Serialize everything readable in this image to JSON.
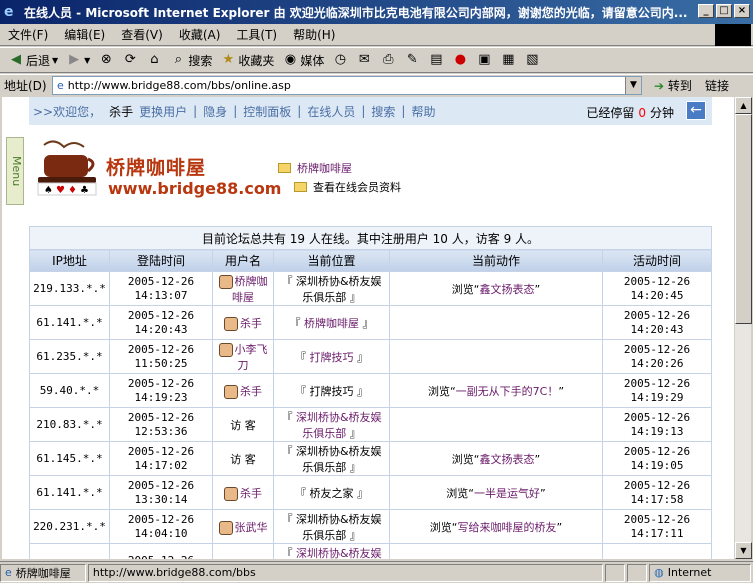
{
  "window": {
    "title": "在线人员 - Microsoft Internet Explorer 由 欢迎光临深圳市比克电池有限公司内部网，谢谢您的光临，请留意公司内...",
    "buttons": [
      "_",
      "□",
      "×"
    ]
  },
  "menubar": [
    "文件(F)",
    "编辑(E)",
    "查看(V)",
    "收藏(A)",
    "工具(T)",
    "帮助(H)"
  ],
  "toolbar": {
    "back": "后退",
    "search": "搜索",
    "favorites": "收藏夹",
    "media": "媒体"
  },
  "address": {
    "label": "地址(D)",
    "url": "http://www.bridge88.com/bbs/online.asp",
    "go": "转到",
    "links": "链接"
  },
  "forum_nav": {
    "welcome": ">>欢迎您，",
    "user": "杀手",
    "items": [
      "更换用户",
      "隐身",
      "控制面板",
      "在线人员",
      "搜索",
      "帮助"
    ],
    "stay_prefix": "已经停留",
    "stay_minutes": "0",
    "stay_suffix": "分钟"
  },
  "menu_tab": "Menu",
  "brand": {
    "cn": "桥牌咖啡屋",
    "en": "www.bridge88.com"
  },
  "breadcrumb": {
    "home": "桥牌咖啡屋",
    "current": "查看在线会员资料"
  },
  "summary": "目前论坛总共有 19 人在线。其中注册用户 10 人，访客 9 人。",
  "columns": [
    "IP地址",
    "登陆时间",
    "用户名",
    "当前位置",
    "当前动作",
    "活动时间"
  ],
  "rows": [
    {
      "ip": "219.133.*.*",
      "login_date": "2005-12-26",
      "login_time": "14:13:07",
      "user": "桥牌咖啡屋",
      "loc": "深圳桥协&桥友娱乐俱乐部",
      "loc_link": false,
      "act_prefix": "浏览",
      "act": "鑫文扬表态",
      "act_date": "2005-12-26",
      "act_time": "14:20:45"
    },
    {
      "ip": "61.141.*.*",
      "login_date": "2005-12-26",
      "login_time": "14:20:43",
      "user": "杀手",
      "loc": "桥牌咖啡屋",
      "loc_link": true,
      "act_prefix": "",
      "act": "",
      "act_date": "2005-12-26",
      "act_time": "14:20:43"
    },
    {
      "ip": "61.235.*.*",
      "login_date": "2005-12-26",
      "login_time": "11:50:25",
      "user": "小李飞刀",
      "loc": "打牌技巧",
      "loc_link": true,
      "act_prefix": "",
      "act": "",
      "act_date": "2005-12-26",
      "act_time": "14:20:26"
    },
    {
      "ip": "59.40.*.*",
      "login_date": "2005-12-26",
      "login_time": "14:19:23",
      "user": "杀手",
      "loc": "打牌技巧",
      "loc_link": false,
      "act_prefix": "浏览",
      "act": "一副无从下手的7C！",
      "act_date": "2005-12-26",
      "act_time": "14:19:29"
    },
    {
      "ip": "210.83.*.*",
      "login_date": "2005-12-26",
      "login_time": "12:53:36",
      "user": "访 客",
      "loc": "深圳桥协&桥友娱乐俱乐部",
      "loc_link": true,
      "act_prefix": "",
      "act": "",
      "act_date": "2005-12-26",
      "act_time": "14:19:13"
    },
    {
      "ip": "61.145.*.*",
      "login_date": "2005-12-26",
      "login_time": "14:17:02",
      "user": "访 客",
      "loc": "深圳桥协&桥友娱乐俱乐部",
      "loc_link": false,
      "act_prefix": "浏览",
      "act": "鑫文扬表态",
      "act_date": "2005-12-26",
      "act_time": "14:19:05"
    },
    {
      "ip": "61.141.*.*",
      "login_date": "2005-12-26",
      "login_time": "13:30:14",
      "user": "杀手",
      "loc": "桥友之家",
      "loc_link": false,
      "act_prefix": "浏览",
      "act": "一半是运气好",
      "act_date": "2005-12-26",
      "act_time": "14:17:58"
    },
    {
      "ip": "220.231.*.*",
      "login_date": "2005-12-26",
      "login_time": "14:04:10",
      "user": "张武华",
      "loc": "深圳桥协&桥友娱乐俱乐部",
      "loc_link": false,
      "act_prefix": "浏览",
      "act": "写给来咖啡屋的桥友",
      "act_date": "2005-12-26",
      "act_time": "14:17:11"
    },
    {
      "ip": "",
      "login_date": "2005-12-26",
      "login_time": "",
      "user": "",
      "loc": "深圳桥协&桥友娱乐",
      "loc_link": true,
      "act_prefix": "",
      "act": "",
      "act_date": "",
      "act_time": ""
    }
  ],
  "status": {
    "left": "桥牌咖啡屋",
    "url": "http://www.bridge88.com/bbs",
    "zone": "Internet"
  }
}
